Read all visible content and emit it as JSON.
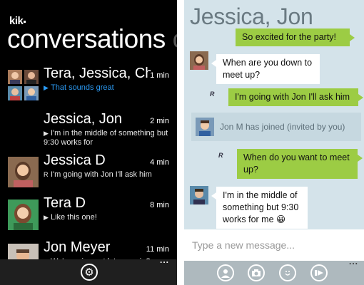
{
  "left_screen": {
    "logo": "kik",
    "title": "conversations",
    "title_peek": "c",
    "conversations": [
      {
        "name": "Tera, Jessica, Ch",
        "time": "1 min",
        "snippet": "That sounds great",
        "snippet_icon": "reply-arrow-icon",
        "snippet_color": "#2b9af3"
      },
      {
        "name": "Jessica, Jon",
        "time": "2 min",
        "snippet": "I'm in the middle of something but 9:30 works for",
        "snippet_icon": "reply-arrow-icon"
      },
      {
        "name": "Jessica D",
        "time": "4 min",
        "snippet": "I'm going with Jon I'll ask him",
        "snippet_icon": "read-receipt-icon"
      },
      {
        "name": "Tera D",
        "time": "8 min",
        "snippet": "Like this one!",
        "snippet_icon": "reply-arrow-icon"
      },
      {
        "name": "Jon Meyer",
        "time": "11 min",
        "snippet": "We're going out later you in?",
        "snippet_icon": "reply-arrow-icon"
      }
    ],
    "appbar": {
      "settings_icon": "gear-icon",
      "more": "..."
    }
  },
  "right_screen": {
    "title": "Jessica, Jon",
    "messages": [
      {
        "type": "out",
        "text": "So excited for the party!"
      },
      {
        "type": "in",
        "text": "When are you down to meet up?"
      },
      {
        "type": "out",
        "text": "I'm going with Jon I'll ask him",
        "receipt": "R"
      },
      {
        "type": "system",
        "text": "Jon M has joined (invited by you)"
      },
      {
        "type": "out",
        "text": "When do you want to meet up?",
        "receipt": "R"
      },
      {
        "type": "in",
        "text": "I'm in the middle of something but 9:30 works for me 😀"
      }
    ],
    "input": {
      "placeholder": "Type a new message..."
    },
    "appbar": {
      "buttons": [
        "person-icon",
        "camera-icon",
        "smiley-icon",
        "send-icon"
      ],
      "more": "..."
    }
  },
  "colors": {
    "left_bg": "#000000",
    "accent_blue": "#2b9af3",
    "chat_bg": "#d4e3ea",
    "outgoing_bubble": "#9ccc44",
    "incoming_bubble": "#ffffff"
  }
}
